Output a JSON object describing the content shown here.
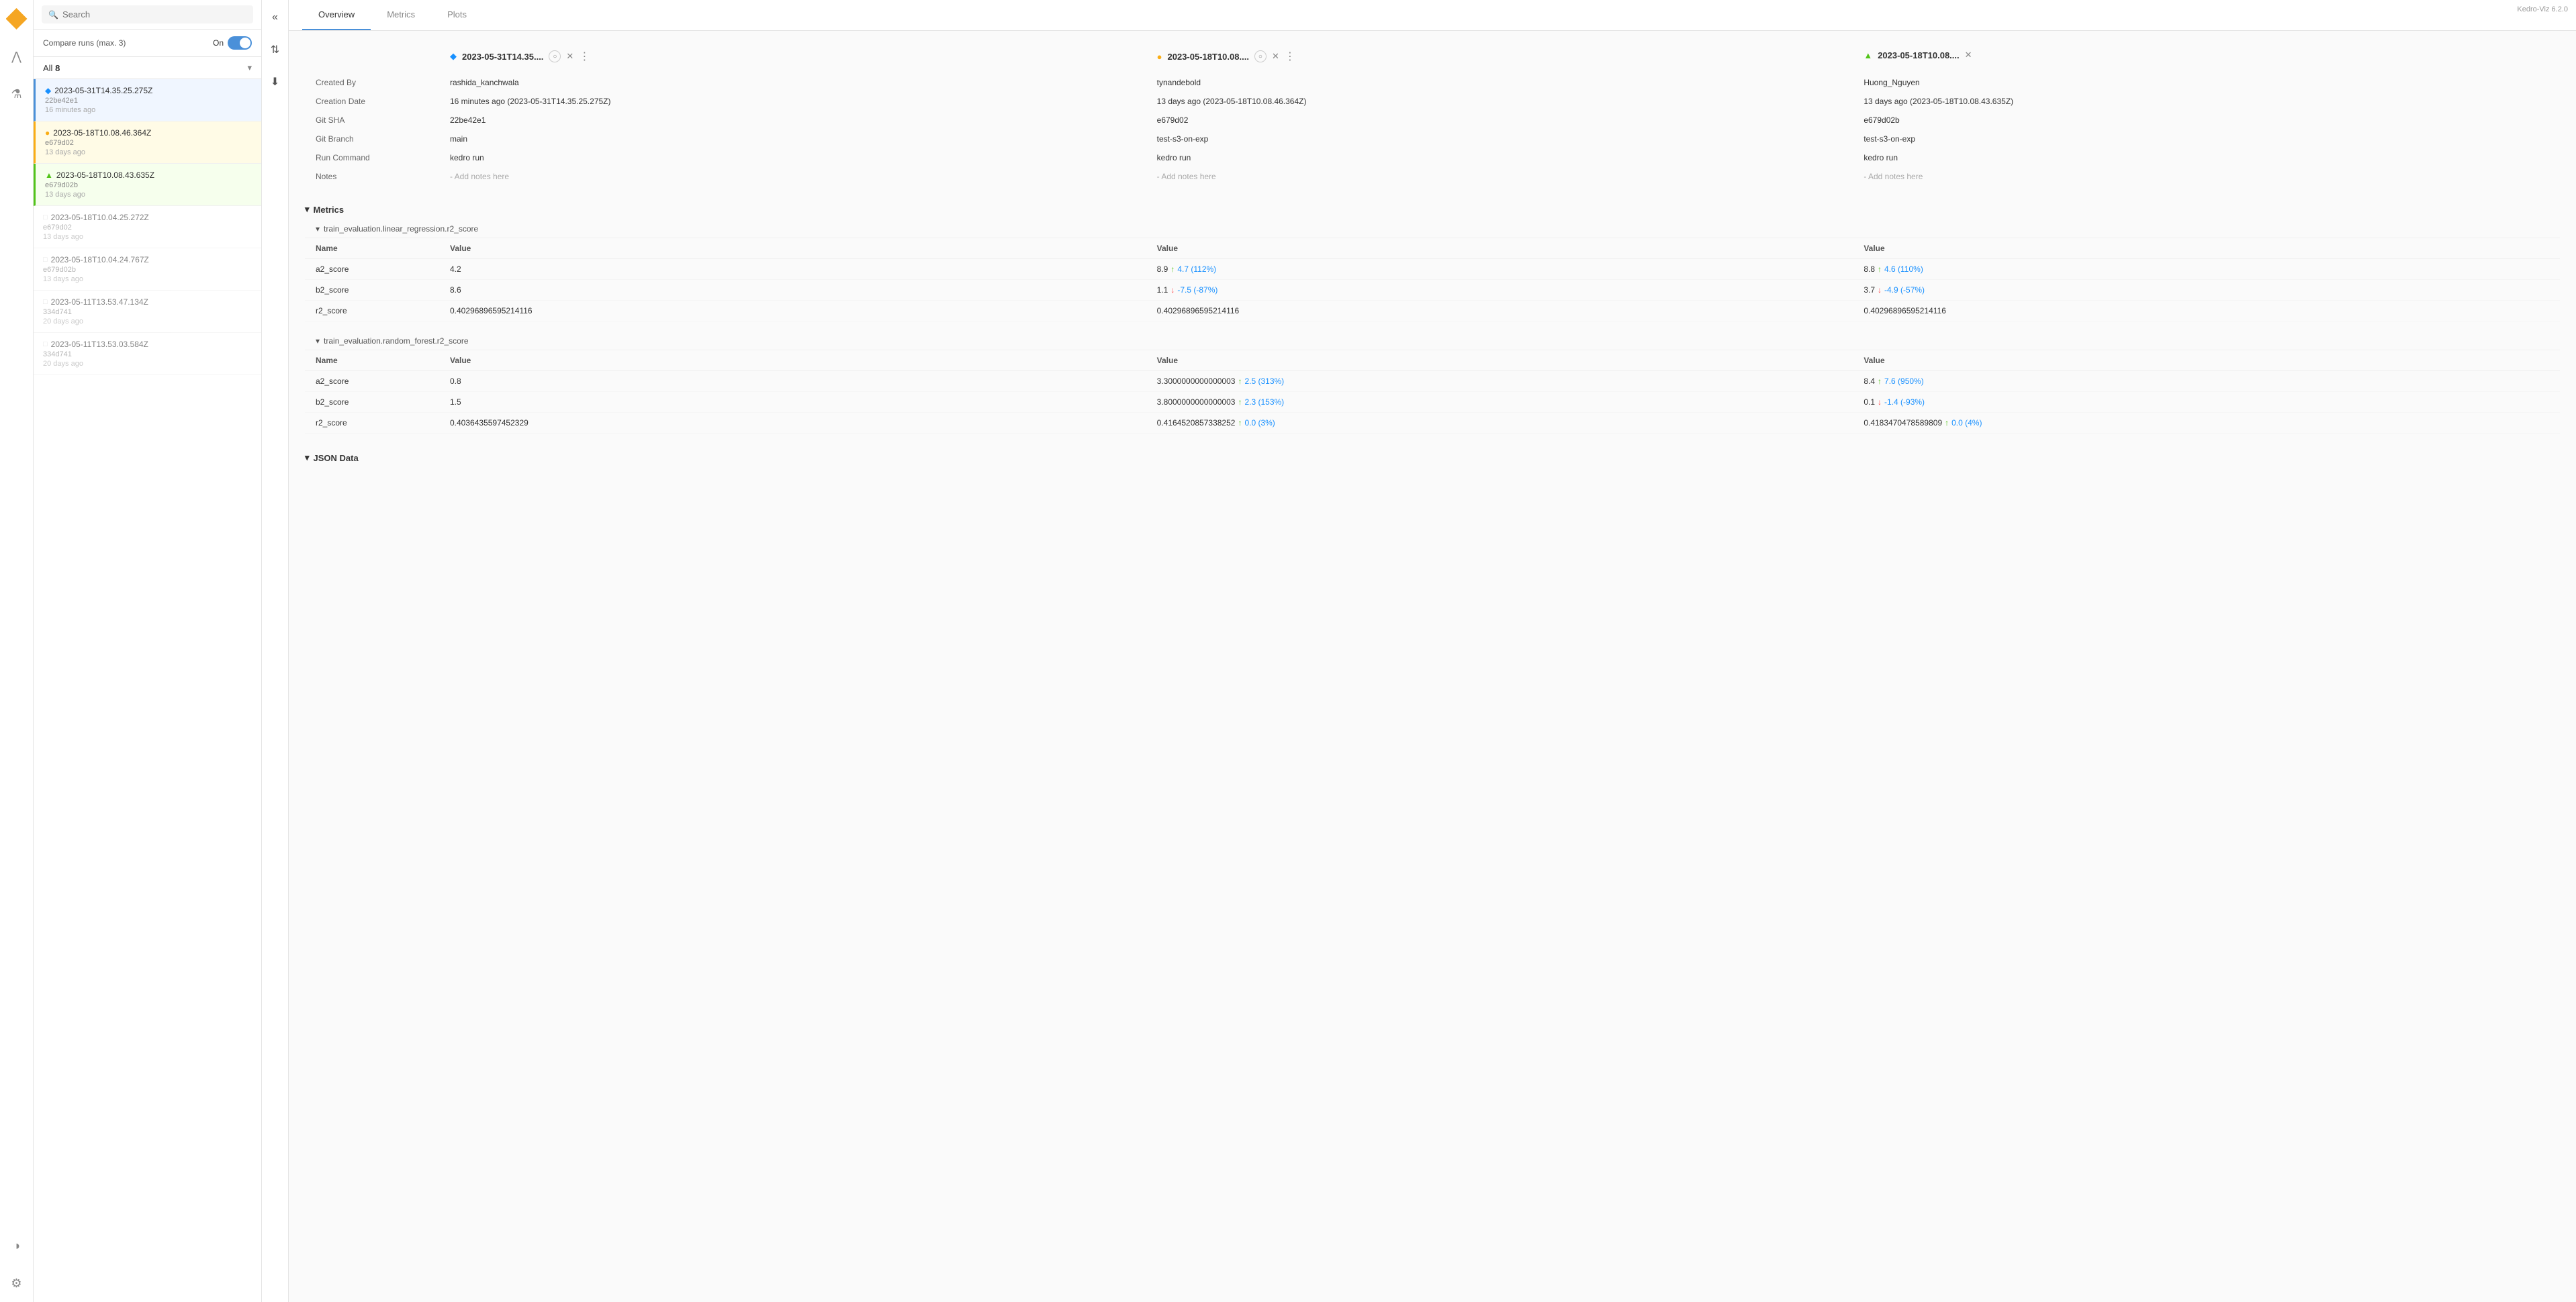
{
  "app": {
    "version": "Kedro-Viz 6.2.0"
  },
  "sidebar": {
    "search_placeholder": "Search",
    "compare_label": "Compare runs (max. 3)",
    "compare_on": "On",
    "filter_label": "All",
    "filter_count": "8",
    "runs": [
      {
        "id": "run1",
        "name": "2023-05-31T14.35.25.275Z",
        "hash": "22be42e1",
        "time": "16 minutes ago",
        "color": "blue",
        "active": true,
        "icon": "◆"
      },
      {
        "id": "run2",
        "name": "2023-05-18T10.08.46.364Z",
        "hash": "e679d02",
        "time": "13 days ago",
        "color": "yellow",
        "active": true,
        "icon": "●"
      },
      {
        "id": "run3",
        "name": "2023-05-18T10.08.43.635Z",
        "hash": "e679d02b",
        "time": "13 days ago",
        "color": "green",
        "active": true,
        "icon": "▲"
      },
      {
        "id": "run4",
        "name": "2023-05-18T10.04.25.272Z",
        "hash": "e679d02",
        "time": "13 days ago",
        "color": "gray",
        "active": false,
        "icon": "□"
      },
      {
        "id": "run5",
        "name": "2023-05-18T10.04.24.767Z",
        "hash": "e679d02b",
        "time": "13 days ago",
        "color": "gray",
        "active": false,
        "icon": "□"
      },
      {
        "id": "run6",
        "name": "2023-05-11T13.53.47.134Z",
        "hash": "334d741",
        "time": "20 days ago",
        "color": "gray",
        "active": false,
        "icon": "□"
      },
      {
        "id": "run7",
        "name": "2023-05-11T13.53.03.584Z",
        "hash": "334d741",
        "time": "20 days ago",
        "color": "gray",
        "active": false,
        "icon": "□"
      }
    ]
  },
  "tabs": [
    {
      "id": "overview",
      "label": "Overview",
      "active": true
    },
    {
      "id": "metrics",
      "label": "Metrics",
      "active": false
    },
    {
      "id": "plots",
      "label": "Plots",
      "active": false
    }
  ],
  "runs_detail": [
    {
      "id": "run1",
      "title": "2023-05-31T14.35....",
      "color": "blue",
      "icon": "◆",
      "created_by": "rashida_kanchwala",
      "creation_date": "16 minutes ago (2023-05-31T14.35.25.275Z)",
      "git_sha": "22be42e1",
      "git_branch": "main",
      "run_command": "kedro run",
      "notes": "- Add notes here"
    },
    {
      "id": "run2",
      "title": "2023-05-18T10.08....",
      "color": "yellow",
      "icon": "●",
      "created_by": "tynandebold",
      "creation_date": "13 days ago (2023-05-18T10.08.46.364Z)",
      "git_sha": "e679d02",
      "git_branch": "test-s3-on-exp",
      "run_command": "kedro run",
      "notes": "- Add notes here"
    },
    {
      "id": "run3",
      "title": "2023-05-18T10.08....",
      "color": "green",
      "icon": "▲",
      "created_by": "Huong_Nguyen",
      "creation_date": "13 days ago (2023-05-18T10.08.43.635Z)",
      "git_sha": "e679d02b",
      "git_branch": "test-s3-on-exp",
      "run_command": "kedro run",
      "notes": "- Add notes here"
    }
  ],
  "info_labels": [
    "Created By",
    "Creation Date",
    "Git SHA",
    "Git Branch",
    "Run Command",
    "Notes"
  ],
  "metrics_section_label": "Metrics",
  "metric_groups": [
    {
      "name": "train_evaluation.linear_regression.r2_score",
      "rows": [
        {
          "name": "a2_score",
          "values": [
            "4.2",
            "8.9",
            "8.8"
          ],
          "diffs": [
            null,
            {
              "dir": "up",
              "val": "4.7 (112%)"
            },
            {
              "dir": "up",
              "val": "4.6 (110%)"
            }
          ]
        },
        {
          "name": "b2_score",
          "values": [
            "8.6",
            "1.1",
            "3.7"
          ],
          "diffs": [
            null,
            {
              "dir": "down",
              "val": "-7.5 (-87%)"
            },
            {
              "dir": "down",
              "val": "-4.9 (-57%)"
            }
          ]
        },
        {
          "name": "r2_score",
          "values": [
            "0.40296896595214116",
            "0.40296896595214116",
            "0.40296896595214116"
          ],
          "diffs": [
            null,
            null,
            null
          ]
        }
      ]
    },
    {
      "name": "train_evaluation.random_forest.r2_score",
      "rows": [
        {
          "name": "a2_score",
          "values": [
            "0.8",
            "3.3000000000000003",
            "8.4"
          ],
          "diffs": [
            null,
            {
              "dir": "up",
              "val": "2.5 (313%)"
            },
            {
              "dir": "up",
              "val": "7.6 (950%)"
            }
          ]
        },
        {
          "name": "b2_score",
          "values": [
            "1.5",
            "3.8000000000000003",
            "0.1"
          ],
          "diffs": [
            null,
            {
              "dir": "up",
              "val": "2.3 (153%)"
            },
            {
              "dir": "down",
              "val": "-1.4 (-93%)"
            }
          ]
        },
        {
          "name": "r2_score",
          "values": [
            "0.4036435597452329",
            "0.4164520857338252",
            "0.4183470478589809"
          ],
          "diffs": [
            null,
            {
              "dir": "up",
              "val": "0.0 (3%)"
            },
            {
              "dir": "up",
              "val": "0.0 (4%)"
            }
          ]
        }
      ]
    }
  ],
  "json_data_label": "JSON Data",
  "icons": {
    "search": "🔍",
    "collapse": "«",
    "sort": "⇅",
    "download": "⬇",
    "pipeline": "⋀",
    "experiment": "⚗",
    "settings": "⚙",
    "theme": "◑",
    "chevron_down": "▾",
    "chevron_right": "▸"
  },
  "colors": {
    "blue": "#1890ff",
    "yellow": "#faad14",
    "green": "#52c41a",
    "gray": "#aaa",
    "accent": "#4a90d9",
    "up_arrow": "#52c41a",
    "down_arrow": "#ff4d4f",
    "diff_text": "#1890ff"
  }
}
